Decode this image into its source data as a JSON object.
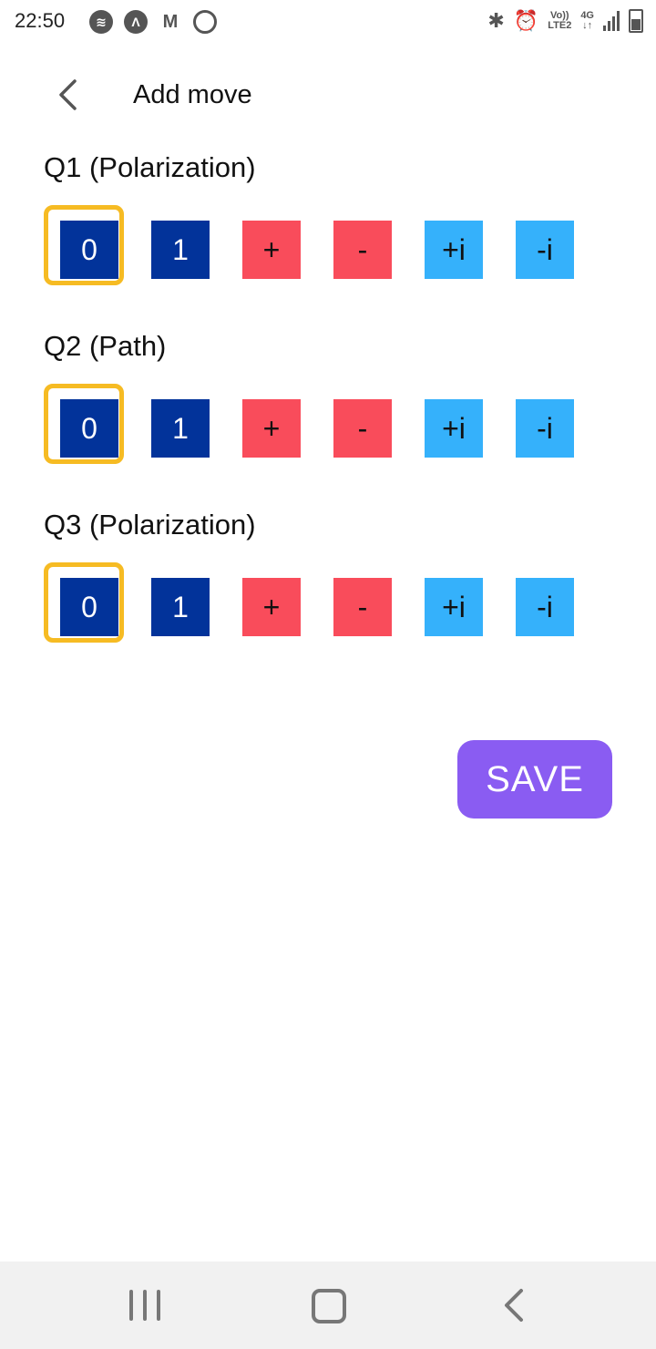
{
  "status": {
    "time": "22:50",
    "left_icons": [
      "spotify-icon",
      "arrow-app-icon",
      "gmail-icon",
      "hotspot-icon"
    ],
    "right_icons": [
      "bluetooth-icon",
      "alarm-icon",
      "volte-icon",
      "4g-icon",
      "signal-icon",
      "battery-icon"
    ],
    "volte_top": "Vo))",
    "volte_bottom": "LTE2",
    "network_top": "4G",
    "network_bottom": "↓↑"
  },
  "header": {
    "title": "Add move"
  },
  "sections": [
    {
      "title": "Q1 (Polarization)",
      "options": [
        "0",
        "1",
        "+",
        "-",
        "+i",
        "-i"
      ],
      "selected": "0"
    },
    {
      "title": "Q2 (Path)",
      "options": [
        "0",
        "1",
        "+",
        "-",
        "+i",
        "-i"
      ],
      "selected": "0"
    },
    {
      "title": "Q3 (Polarization)",
      "options": [
        "0",
        "1",
        "+",
        "-",
        "+i",
        "-i"
      ],
      "selected": "0"
    }
  ],
  "save_label": "SAVE",
  "colors": {
    "dark_blue": "#02339a",
    "red": "#f94c5b",
    "light_blue": "#35b1fb",
    "selection_ring": "#f6bb23",
    "save_button": "#8a5cf2"
  }
}
